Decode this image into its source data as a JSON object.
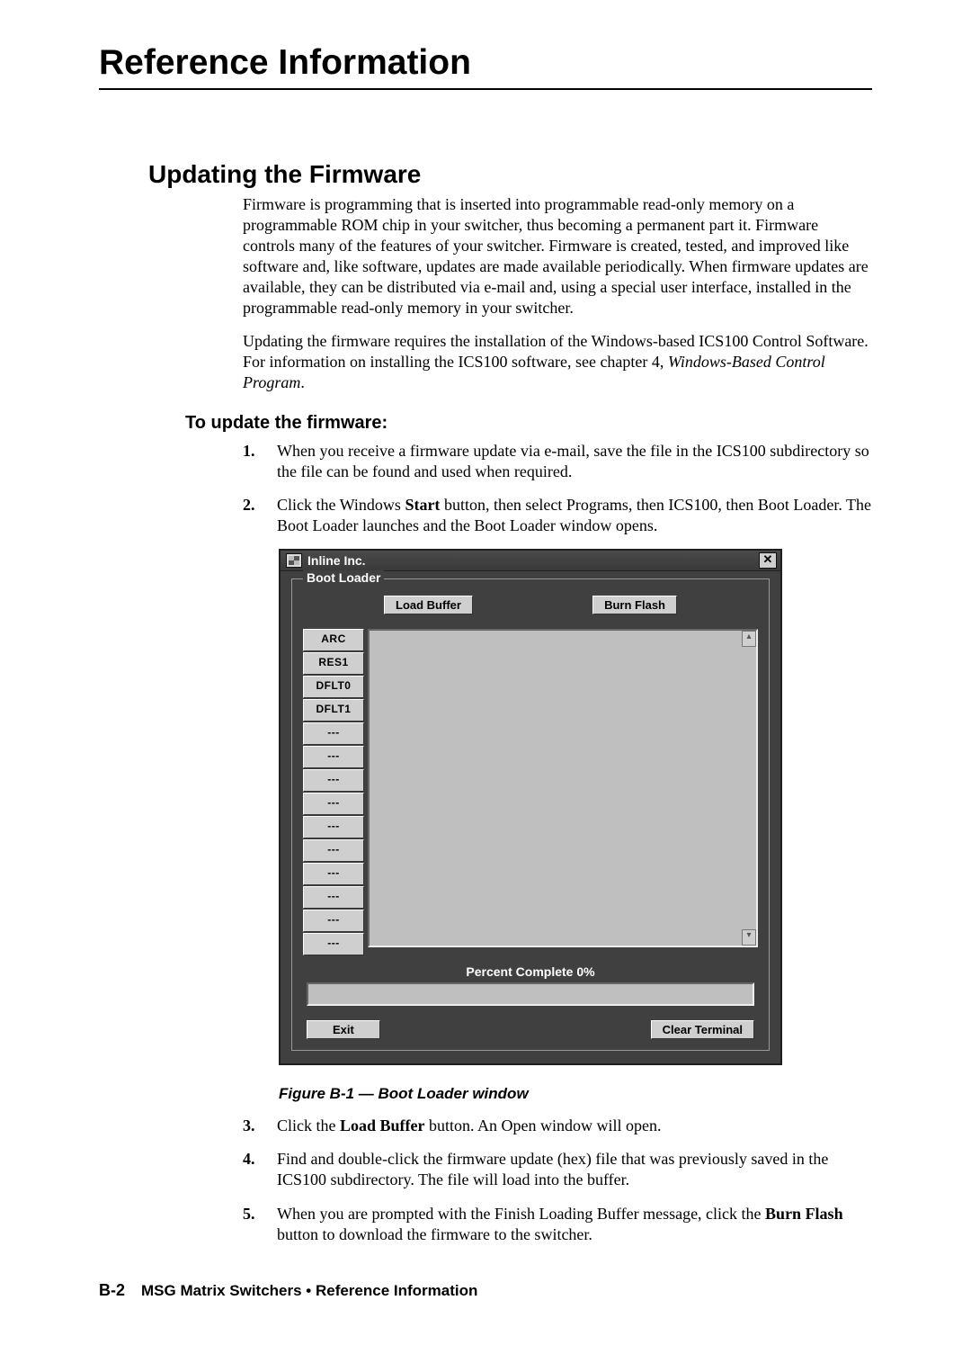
{
  "header": {
    "title": "Reference Information"
  },
  "section": {
    "title": "Updating the Firmware"
  },
  "intro": {
    "p1": "Firmware is programming that is inserted into programmable read-only memory on a programmable ROM chip in your switcher, thus becoming a permanent part it. Firmware controls many of the features of your switcher.  Firmware is created, tested, and improved like software and, like software, updates are made available periodically.  When firmware updates are available, they can be distributed via e-mail and, using a special user interface, installed in the programmable read-only memory in your switcher.",
    "p2a": "Updating the firmware requires the installation of the Windows-based ICS100 Control Software.  For information on installing the ICS100 software, see chapter 4, ",
    "p2b": "Windows-Based Control Program",
    "p2c": "."
  },
  "subhead": "To update the firmware:",
  "steps": {
    "s1": {
      "n": "1.",
      "t": "When you receive a firmware update via e-mail, save the file in the ICS100 subdirectory so the file can be found and used when required."
    },
    "s2": {
      "n": "2.",
      "a": "Click the Windows ",
      "b": "Start",
      "c": " button, then select Programs, then ICS100, then Boot Loader.  The Boot Loader launches and the Boot Loader window opens."
    },
    "s3": {
      "n": "3.",
      "a": "Click the ",
      "b": "Load Buffer",
      "c": " button.  An Open window will open."
    },
    "s4": {
      "n": "4.",
      "t": "Find and double-click the firmware update (hex) file that was previously saved in the ICS100 subdirectory.  The file will load into the buffer."
    },
    "s5": {
      "n": "5.",
      "a": "When you are prompted with the Finish Loading Buffer message, click the ",
      "b": "Burn Flash",
      "c": " button to download the firmware to the switcher."
    }
  },
  "bootloader": {
    "title": "Inline Inc.",
    "close": "✕",
    "legend": "Boot Loader",
    "load_buffer": "Load Buffer",
    "burn_flash": "Burn Flash",
    "side": [
      "ARC",
      "RES1",
      "DFLT0",
      "DFLT1",
      "---",
      "---",
      "---",
      "---",
      "---",
      "---",
      "---",
      "---",
      "---",
      "---"
    ],
    "percent": "Percent Complete 0%",
    "exit": "Exit",
    "clear": "Clear Terminal",
    "scroll_up": "▴",
    "scroll_dn": "▾"
  },
  "figure": {
    "caption": "Figure B-1 — Boot Loader window"
  },
  "footer": {
    "page": "B-2",
    "text": "MSG Matrix Switchers • Reference Information"
  }
}
